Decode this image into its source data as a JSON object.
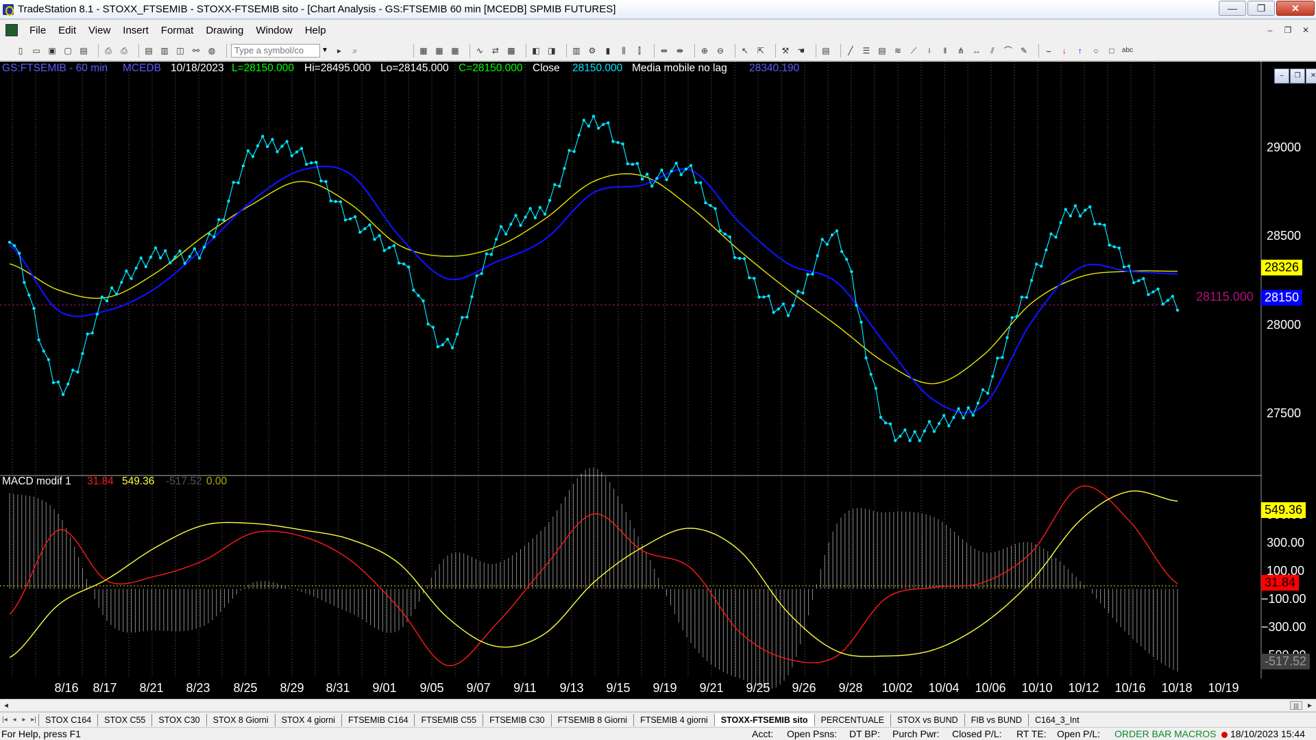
{
  "window": {
    "title": "TradeStation 8.1 - STOXX_FTSEMIB - STOXX-FTSEMIB sito - [Chart Analysis - GS:FTSEMIB  60 min  [MCEDB] SPMIB FUTURES]",
    "buttons": {
      "minimize": "—",
      "restore": "❐",
      "close": "✕"
    }
  },
  "menubar": {
    "items": [
      "File",
      "Edit",
      "View",
      "Insert",
      "Format",
      "Drawing",
      "Window",
      "Help"
    ],
    "mdi": {
      "minimize": "–",
      "restore": "❐",
      "close": "✕"
    }
  },
  "toolbar": {
    "symbol_placeholder": "Type a symbol/co"
  },
  "chart": {
    "header": {
      "symbol": "GS:FTSEMIB - 60 min",
      "study": "MCEDB",
      "date": "10/18/2023",
      "last": "L=28150.000",
      "high": "Hi=28495.000",
      "low": "Lo=28145.000",
      "close_eq": "C=28150.000",
      "close_label": "Close",
      "close_value": "28150.000",
      "ma_label": "Media mobile no lag",
      "ma_value": "28340.190"
    },
    "price_axis": [
      "29000",
      "28500",
      "28000",
      "27500"
    ],
    "price_boxes": {
      "yellow": "28326",
      "blue": "28150",
      "dashed_value": "28115.000"
    },
    "macd_header": {
      "name": "MACD modif 1",
      "v1": "31.84",
      "v2": "549.36",
      "v3": "-517.52",
      "v4": "0.00"
    },
    "macd_axis": [
      "300.00",
      "100.00",
      "−100.00",
      "−300.00"
    ],
    "macd_axis_partial": {
      "top": "500.00",
      "bottom": "−500.00"
    },
    "macd_boxes": {
      "yellow": "549.36",
      "red": "31.84",
      "gray": "-517.52"
    },
    "dates": [
      "8/16",
      "8/17",
      "8/21",
      "8/23",
      "8/25",
      "8/29",
      "8/31",
      "9/01",
      "9/05",
      "9/07",
      "9/11",
      "9/13",
      "9/15",
      "9/19",
      "9/21",
      "9/25",
      "9/26",
      "9/28",
      "10/02",
      "10/04",
      "10/06",
      "10/10",
      "10/12",
      "10/16",
      "10/18",
      "10/19"
    ],
    "colors": {
      "price": "#00e5ff",
      "ma_fast": "#1010ff",
      "ma_slow": "#e8e800",
      "macd_red": "#ff1a1a",
      "macd_yellow": "#ffff40",
      "histogram": "#8a8a8a",
      "dashed": "#b0107a",
      "header_green": "#00ff00",
      "header_blue": "#5a5aff"
    }
  },
  "chart_data": {
    "type": "line",
    "title": "GS:FTSEMIB - 60 min",
    "x": [
      "8/16",
      "8/17",
      "8/21",
      "8/23",
      "8/25",
      "8/29",
      "8/31",
      "9/01",
      "9/05",
      "9/07",
      "9/11",
      "9/13",
      "9/15",
      "9/19",
      "9/21",
      "9/25",
      "9/26",
      "9/28",
      "10/02",
      "10/04",
      "10/06",
      "10/10",
      "10/12",
      "10/16",
      "10/18"
    ],
    "ylim": [
      27300,
      29350
    ],
    "series": [
      {
        "name": "Close",
        "values": [
          28540,
          27730,
          28200,
          28420,
          28460,
          28980,
          28960,
          28620,
          28420,
          27950,
          28520,
          28690,
          29150,
          28850,
          28860,
          28400,
          28130,
          28520,
          27530,
          27520,
          27680,
          28300,
          28680,
          28350,
          28150
        ]
      },
      {
        "name": "Media mobile no lag",
        "values": [
          28480,
          28130,
          28130,
          28250,
          28470,
          28720,
          28880,
          28860,
          28530,
          28300,
          28390,
          28510,
          28760,
          28800,
          28880,
          28600,
          28380,
          28280,
          27950,
          27650,
          27620,
          28070,
          28360,
          28340,
          28326
        ]
      },
      {
        "name": "",
        "values": [
          28380,
          28240,
          28200,
          28330,
          28530,
          28700,
          28820,
          28700,
          28480,
          28420,
          28470,
          28620,
          28820,
          28850,
          28680,
          28450,
          28240,
          28050,
          27850,
          27740,
          27890,
          28170,
          28310,
          28340,
          28340
        ]
      }
    ],
    "macd": {
      "name": "MACD modif 1",
      "ylim": [
        -560,
        620
      ],
      "series": [
        {
          "name": "",
          "values": [
            -160,
            370,
            50,
            80,
            180,
            350,
            330,
            180,
            -120,
            -480,
            -220,
            140,
            470,
            240,
            130,
            -270,
            -440,
            -420,
            -60,
            10,
            40,
            230,
            640,
            430,
            31.84
          ]
        },
        {
          "name": "",
          "values": [
            -430,
            -100,
            60,
            260,
            400,
            410,
            370,
            310,
            160,
            -180,
            -360,
            -280,
            40,
            260,
            380,
            240,
            -150,
            -390,
            -420,
            -380,
            -220,
            50,
            430,
            610,
            549.36
          ]
        },
        {
          "name": "",
          "values": [
            600,
            470,
            -200,
            -260,
            -230,
            40,
            -20,
            -150,
            -260,
            210,
            160,
            390,
            760,
            280,
            -340,
            -560,
            -540,
            410,
            480,
            450,
            230,
            290,
            50,
            -290,
            -517.52
          ]
        }
      ]
    }
  },
  "tabs": [
    "STOX C164",
    "STOX C55",
    "STOX  C30",
    "STOX  8 Giorni",
    "STOX 4 giorni",
    "FTSEMIB C164",
    "FTSEMIB C55",
    "FTSEMIB C30",
    "FTSEMIB  8 Giorni",
    "FTSEMIB  4 giorni",
    "STOXX-FTSEMIB sito",
    "PERCENTUALE",
    "STOX vs BUND",
    "FIB vs BUND",
    "C164_3_Int"
  ],
  "active_tab": "STOXX-FTSEMIB sito",
  "statusbar": {
    "help": "For Help, press F1",
    "acct": "Acct:",
    "open_psns": "Open Psns:",
    "dt_bp": "DT BP:",
    "purch_pwr": "Purch Pwr:",
    "closed_pl": "Closed P/L:",
    "rt_te": "RT TE:",
    "open_pl": "Open P/L:",
    "order_bar": "ORDER BAR",
    "macros": "MACROS",
    "datetime": "18/10/2023 15:44"
  }
}
